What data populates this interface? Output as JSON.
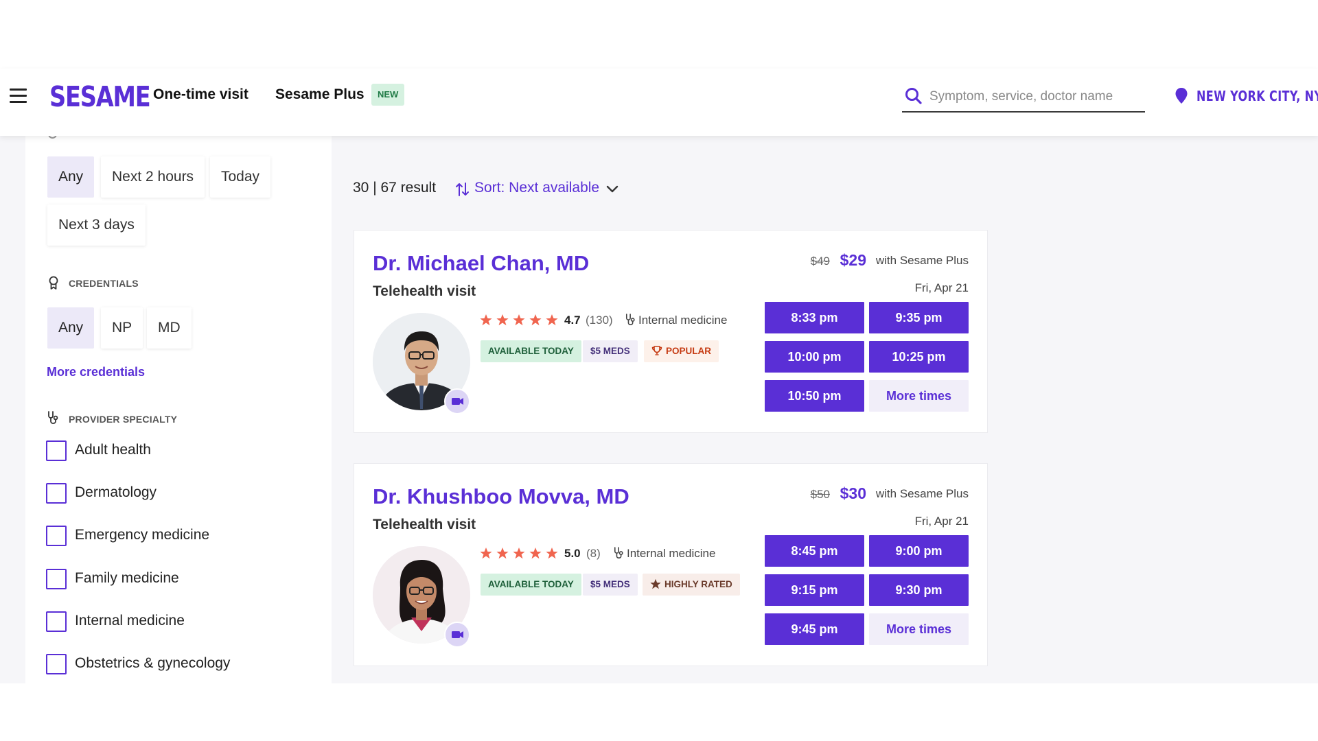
{
  "header": {
    "logo": "SESAME",
    "nav": [
      {
        "label": "One-time visit"
      },
      {
        "label": "Sesame Plus",
        "badge": "NEW"
      }
    ],
    "search": {
      "placeholder": "Symptom, service, doctor name",
      "value": ""
    },
    "location": "NEW YORK CITY, NY"
  },
  "sidebar": {
    "availability": {
      "options": [
        "Any",
        "Next 2 hours",
        "Today",
        "Next 3 days"
      ],
      "selected": "Any"
    },
    "credentials": {
      "title": "CREDENTIALS",
      "options": [
        "Any",
        "NP",
        "MD"
      ],
      "selected": "Any",
      "more_link": "More credentials"
    },
    "specialty": {
      "title": "PROVIDER SPECIALTY",
      "options": [
        "Adult health",
        "Dermatology",
        "Emergency medicine",
        "Family medicine",
        "Internal medicine",
        "Obstetrics & gynecology"
      ]
    }
  },
  "results": {
    "count": "30 | 67 result",
    "sort_label": "Sort: Next available"
  },
  "providers": [
    {
      "name": "Dr. Michael Chan, MD",
      "visit_type": "Telehealth visit",
      "rating": "4.7",
      "reviews": "(130)",
      "specialty": "Internal medicine",
      "badges": [
        "AVAILABLE TODAY",
        "$5 MEDS",
        "POPULAR"
      ],
      "old_price": "$49",
      "price": "$29",
      "price_note": "with Sesame Plus",
      "date": "Fri, Apr 21",
      "slots": [
        "8:33 pm",
        "9:35 pm",
        "10:00 pm",
        "10:25 pm",
        "10:50 pm",
        "More times"
      ]
    },
    {
      "name": "Dr. Khushboo Movva, MD",
      "visit_type": "Telehealth visit",
      "rating": "5.0",
      "reviews": "(8)",
      "specialty": "Internal medicine",
      "badges": [
        "AVAILABLE TODAY",
        "$5 MEDS",
        "HIGHLY RATED"
      ],
      "old_price": "$50",
      "price": "$30",
      "price_note": "with Sesame Plus",
      "date": "Fri, Apr 21",
      "slots": [
        "8:45 pm",
        "9:00 pm",
        "9:15 pm",
        "9:30 pm",
        "9:45 pm",
        "More times"
      ]
    }
  ],
  "colors": {
    "brand": "#5a2fd6",
    "slot_button": "#5a2fd6",
    "star": "#f0654f",
    "badge_available_bg": "#d5f1e0",
    "badge_popular_text": "#c53a12"
  }
}
